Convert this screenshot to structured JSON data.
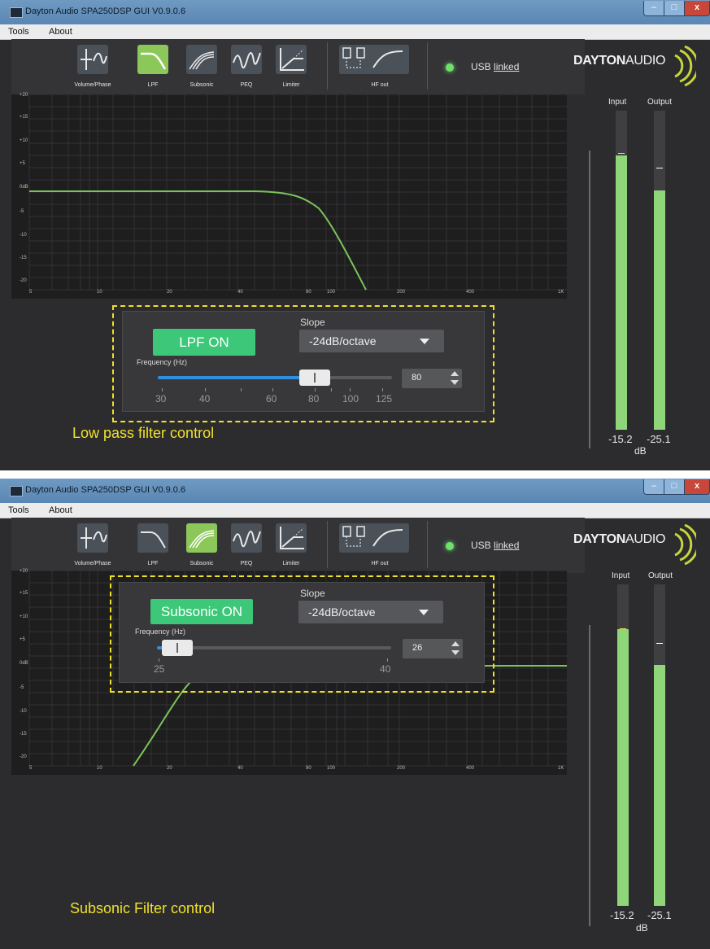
{
  "windows": [
    {
      "title": "Dayton Audio SPA250DSP GUI V0.9.0.6",
      "menu": [
        "Tools",
        "About"
      ],
      "toolbar": [
        "Volume/Phase",
        "LPF",
        "Subsonic",
        "PEQ",
        "Limiter",
        "HF out"
      ],
      "active_tab": "LPF",
      "usb_prefix": "USB",
      "usb_status": "linked",
      "logo_bold": "DAYTON",
      "logo_light": "AUDIO",
      "graph": {
        "y_labels": [
          "+20",
          "+15",
          "+10",
          "+5",
          "0dB",
          "-5",
          "-10",
          "-15",
          "-20"
        ],
        "x_labels": [
          "5",
          "10",
          "20",
          "40",
          "80",
          "100",
          "200",
          "400",
          "1K"
        ],
        "curve_color": "#7cc45a"
      },
      "control": {
        "button": "LPF ON",
        "slope_label": "Slope",
        "slope_value": "-24dB/octave",
        "freq_label": "Frequency (Hz)",
        "ticks": [
          "30",
          "40",
          "60",
          "80",
          "100",
          "125"
        ],
        "value": "80",
        "slider_fraction": 0.67,
        "caption": "Low pass filter control"
      },
      "meters": {
        "input_label": "Input",
        "output_label": "Output",
        "input_value": "-15.2",
        "output_value": "-25.1",
        "unit": "dB",
        "input_level": 0.86,
        "output_level": 0.75
      }
    },
    {
      "title": "Dayton Audio SPA250DSP GUI V0.9.0.6",
      "menu": [
        "Tools",
        "About"
      ],
      "toolbar": [
        "Volume/Phase",
        "LPF",
        "Subsonic",
        "PEQ",
        "Limiter",
        "HF out"
      ],
      "active_tab": "Subsonic",
      "usb_prefix": "USB",
      "usb_status": "linked",
      "logo_bold": "DAYTON",
      "logo_light": "AUDIO",
      "graph": {
        "y_labels": [
          "+20",
          "+15",
          "+10",
          "+5",
          "0dB",
          "-5",
          "-10",
          "-15",
          "-20"
        ],
        "x_labels": [
          "5",
          "10",
          "20",
          "40",
          "80",
          "100",
          "200",
          "400",
          "1K"
        ],
        "curve_color": "#7cc45a"
      },
      "control": {
        "button": "Subsonic ON",
        "slope_label": "Slope",
        "slope_value": "-24dB/octave",
        "freq_label": "Frequency (Hz)",
        "ticks": [
          "25",
          "40"
        ],
        "value": "26",
        "slider_fraction": 0.07,
        "caption": "Subsonic Filter control"
      },
      "meters": {
        "input_label": "Input",
        "output_label": "Output",
        "input_value": "-15.2",
        "output_value": "-25.1",
        "unit": "dB",
        "input_level": 0.86,
        "output_level": 0.75
      }
    }
  ]
}
